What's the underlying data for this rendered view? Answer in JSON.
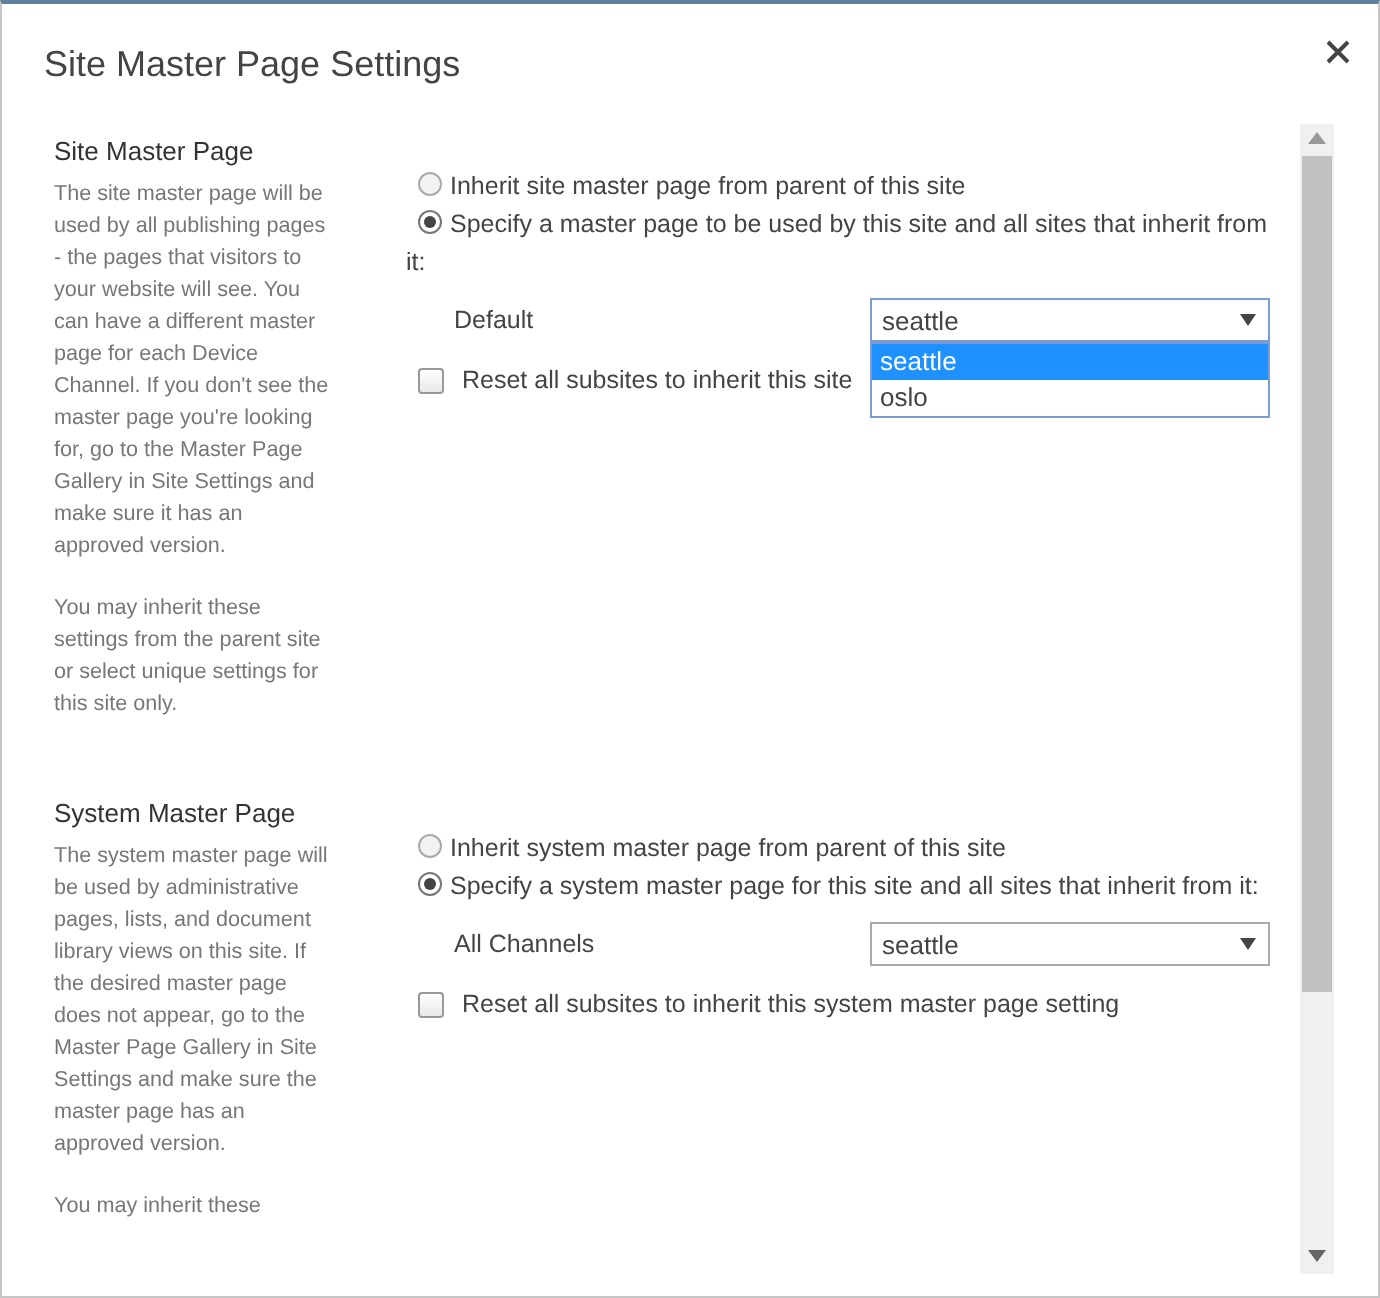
{
  "dialog": {
    "title": "Site Master Page Settings"
  },
  "sections": [
    {
      "heading": "Site Master Page",
      "paragraphs": [
        "The site master page will be used by all publishing pages - the pages that visitors to your website will see. You can have a different master page for each Device Channel. If you don't see the master page you're looking for, go to the Master Page Gallery in Site Settings and make sure it has an approved version.",
        "You may inherit these settings from the parent site or select unique settings for this site only."
      ],
      "radios": [
        {
          "label": "Inherit site master page from parent of this site",
          "selected": false
        },
        {
          "label": "Specify a master page to be used by this site and all sites that inherit from it:",
          "selected": true
        }
      ],
      "channel_label": "Default",
      "dropdown": {
        "value": "seattle",
        "expanded": true,
        "options": [
          {
            "label": "seattle",
            "selected": true
          },
          {
            "label": "oslo",
            "selected": false
          }
        ]
      },
      "reset_checkbox": {
        "label": "Reset all subsites to inherit this site",
        "checked": false
      }
    },
    {
      "heading": "System Master Page",
      "paragraphs": [
        "The system master page will be used by administrative pages, lists, and document library views on this site. If the desired master page does not appear, go to the Master Page Gallery in Site Settings and make sure the master page has an approved version.",
        "You may inherit these"
      ],
      "radios": [
        {
          "label": "Inherit system master page from parent of this site",
          "selected": false
        },
        {
          "label": "Specify a system master page for this site and all sites that inherit from it:",
          "selected": true
        }
      ],
      "channel_label": "All Channels",
      "dropdown": {
        "value": "seattle",
        "expanded": false
      },
      "reset_checkbox": {
        "label": "Reset all subsites to inherit this system master page setting",
        "checked": false
      }
    }
  ]
}
